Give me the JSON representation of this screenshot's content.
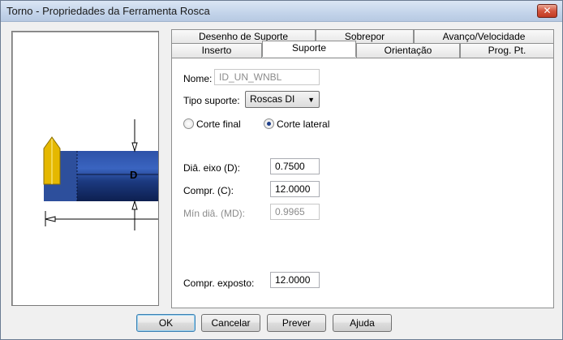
{
  "window": {
    "title": "Torno - Propriedades da Ferramenta Rosca"
  },
  "preview": {
    "dimension_label": "D"
  },
  "tabs": {
    "row1": [
      "Desenho de Suporte",
      "Sobrepor",
      "Avanço/Velocidade"
    ],
    "row2": [
      "Inserto",
      "Suporte",
      "Orientação",
      "Prog. Pt."
    ],
    "active": "Suporte"
  },
  "form": {
    "name_label": "Nome:",
    "name_value": "ID_UN_WNBL",
    "holder_type_label": "Tipo suporte:",
    "holder_type_value": "Roscas DI",
    "radio_face": "Corte final",
    "radio_side": "Corte lateral",
    "radio_selected": "Corte lateral",
    "shaft_dia_label": "Diâ. eixo (D):",
    "shaft_dia_value": "0.7500",
    "length_label": "Compr. (C):",
    "length_value": "12.0000",
    "min_dia_label": "Mín diâ. (MD):",
    "min_dia_value": "0.9965",
    "exposed_length_label": "Compr. exposto:",
    "exposed_length_value": "12.0000"
  },
  "buttons": {
    "ok": "OK",
    "cancel": "Cancelar",
    "preview": "Prever",
    "help": "Ajuda"
  },
  "colors": {
    "holder_blue": "#1c3a80",
    "insert_gold": "#e5b800"
  }
}
